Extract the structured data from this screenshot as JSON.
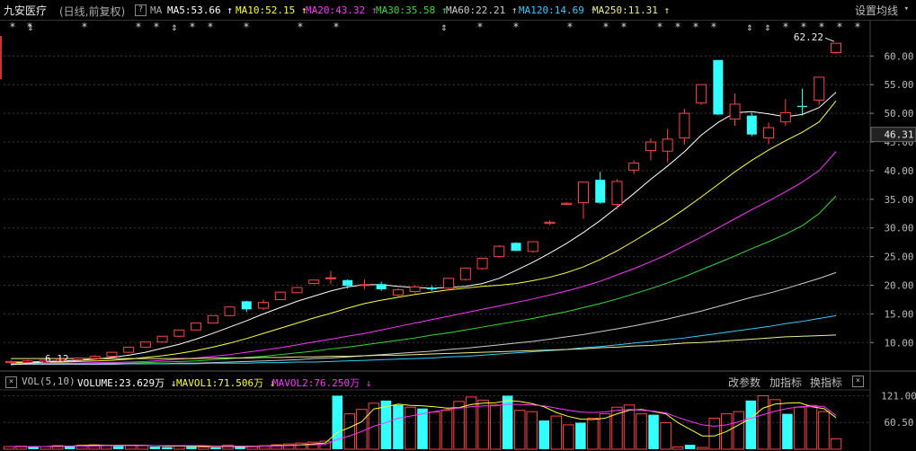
{
  "header": {
    "title": "九安医疗",
    "subtitle": "(日线,前复权)",
    "help_glyph": "?",
    "ma_label": "MA",
    "ma_items": [
      {
        "label": "MA5:53.66",
        "arrow": "↑",
        "color": "#ffffff"
      },
      {
        "label": "MA10:52.15",
        "arrow": "↑",
        "color": "#ffff33"
      },
      {
        "label": "MA20:43.32",
        "arrow": "↑",
        "color": "#ff33ff"
      },
      {
        "label": "MA30:35.58",
        "arrow": "↑",
        "color": "#33dd33"
      },
      {
        "label": "MA60:22.21",
        "arrow": "↑",
        "color": "#cccccc"
      },
      {
        "label": "MA120:14.69",
        "arrow": "↑",
        "color": "#33ccff"
      },
      {
        "label": "MA250:11.31",
        "arrow": "↑",
        "color": "#eeee88"
      }
    ],
    "settings_label": "设置均线",
    "settings_caret": "▾"
  },
  "volume_header": {
    "close_glyph": "×",
    "label": "VOL(5,10)",
    "items": [
      {
        "label": "VOLUME:23.629万",
        "arrow": "↓",
        "color": "#ffffff"
      },
      {
        "label": "MAVOL1:71.506万",
        "arrow": "↓",
        "color": "#ffff33"
      },
      {
        "label": "MAVOL2:76.250万",
        "arrow": "↓",
        "color": "#ff33ff"
      }
    ],
    "buttons": [
      "改参数",
      "加指标",
      "换指标"
    ],
    "panel_close": "×"
  },
  "chart_data": {
    "type": "candlestick",
    "price_axis": {
      "ticks": [
        10,
        15,
        20,
        25,
        30,
        35,
        40,
        45,
        50,
        55,
        60
      ],
      "labels": [
        "10.00",
        "15.00",
        "20.00",
        "25.00",
        "30.00",
        "35.00",
        "40.00",
        "45.00",
        "50.00",
        "55.00",
        "60.00"
      ],
      "ylim": [
        5.5,
        63.5
      ]
    },
    "current_price_label": "46.31",
    "current_price": 46.31,
    "high_label": "62.22",
    "high_value": 62.22,
    "low_label": "6.12",
    "low_value": 6.12,
    "event_markers": [
      "*",
      "*",
      "*",
      "*",
      "*",
      "*",
      "*",
      "*",
      "*",
      "*",
      "*",
      "*",
      "*",
      "*",
      "*",
      "*",
      "*",
      "*",
      "*",
      "*",
      "*",
      "*",
      "*",
      "*",
      "*",
      "*",
      "*",
      "*",
      "*"
    ],
    "candles": [
      {
        "o": 6.5,
        "c": 6.7,
        "h": 6.9,
        "l": 6.3
      },
      {
        "o": 6.5,
        "c": 6.8,
        "h": 7.0,
        "l": 6.4
      },
      {
        "o": 6.6,
        "c": 6.9,
        "h": 7.0,
        "l": 6.5
      },
      {
        "o": 6.8,
        "c": 7.1,
        "h": 7.2,
        "l": 6.7
      },
      {
        "o": 7.0,
        "c": 7.3,
        "h": 7.4,
        "l": 6.9
      },
      {
        "o": 7.2,
        "c": 7.6,
        "h": 7.8,
        "l": 7.1
      },
      {
        "o": 7.6,
        "c": 8.3,
        "h": 8.4,
        "l": 7.5
      },
      {
        "o": 8.3,
        "c": 9.2,
        "h": 9.2,
        "l": 8.2
      },
      {
        "o": 9.2,
        "c": 10.1,
        "h": 10.1,
        "l": 9.1
      },
      {
        "o": 10.1,
        "c": 11.1,
        "h": 11.1,
        "l": 10.0
      },
      {
        "o": 11.1,
        "c": 12.2,
        "h": 12.2,
        "l": 11.0
      },
      {
        "o": 12.2,
        "c": 13.4,
        "h": 13.4,
        "l": 12.1
      },
      {
        "o": 13.4,
        "c": 14.7,
        "h": 14.7,
        "l": 13.3
      },
      {
        "o": 14.7,
        "c": 16.2,
        "h": 16.2,
        "l": 14.6
      },
      {
        "o": 17.2,
        "c": 15.8,
        "h": 17.3,
        "l": 15.3
      },
      {
        "o": 16.0,
        "c": 17.0,
        "h": 17.5,
        "l": 15.7
      },
      {
        "o": 17.5,
        "c": 18.8,
        "h": 18.9,
        "l": 17.4
      },
      {
        "o": 18.7,
        "c": 19.6,
        "h": 19.7,
        "l": 18.6
      },
      {
        "o": 20.3,
        "c": 20.9,
        "h": 21.0,
        "l": 20.2
      },
      {
        "o": 21.3,
        "c": 21.3,
        "h": 22.5,
        "l": 20.2
      },
      {
        "o": 20.9,
        "c": 19.9,
        "h": 21.0,
        "l": 19.4
      },
      {
        "o": 20.0,
        "c": 20.1,
        "h": 21.0,
        "l": 19.3
      },
      {
        "o": 20.2,
        "c": 19.3,
        "h": 20.6,
        "l": 19.0
      },
      {
        "o": 18.3,
        "c": 19.2,
        "h": 19.5,
        "l": 18.0
      },
      {
        "o": 18.9,
        "c": 19.7,
        "h": 20.0,
        "l": 18.6
      },
      {
        "o": 19.6,
        "c": 19.3,
        "h": 19.9,
        "l": 19.0
      },
      {
        "o": 19.5,
        "c": 21.2,
        "h": 21.3,
        "l": 19.1
      },
      {
        "o": 21.0,
        "c": 23.0,
        "h": 23.1,
        "l": 20.8
      },
      {
        "o": 22.9,
        "c": 24.7,
        "h": 24.8,
        "l": 22.7
      },
      {
        "o": 25.0,
        "c": 26.8,
        "h": 27.0,
        "l": 24.8
      },
      {
        "o": 27.4,
        "c": 26.0,
        "h": 27.5,
        "l": 26.0
      },
      {
        "o": 25.9,
        "c": 27.6,
        "h": 27.7,
        "l": 25.7
      },
      {
        "o": 30.8,
        "c": 31.0,
        "h": 31.3,
        "l": 30.5
      },
      {
        "o": 34.1,
        "c": 34.3,
        "h": 34.5,
        "l": 34.0
      },
      {
        "o": 34.4,
        "c": 38.0,
        "h": 38.0,
        "l": 31.6
      },
      {
        "o": 38.4,
        "c": 34.4,
        "h": 39.8,
        "l": 34.2
      },
      {
        "o": 34.1,
        "c": 38.1,
        "h": 38.5,
        "l": 33.2
      },
      {
        "o": 40.1,
        "c": 41.3,
        "h": 41.8,
        "l": 39.4
      },
      {
        "o": 43.5,
        "c": 45.0,
        "h": 45.6,
        "l": 41.8
      },
      {
        "o": 43.4,
        "c": 45.5,
        "h": 47.3,
        "l": 41.5
      },
      {
        "o": 45.7,
        "c": 50.0,
        "h": 50.8,
        "l": 44.5
      },
      {
        "o": 51.8,
        "c": 55.0,
        "h": 55.0,
        "l": 51.5
      },
      {
        "o": 59.3,
        "c": 49.8,
        "h": 59.3,
        "l": 49.7
      },
      {
        "o": 49.0,
        "c": 51.6,
        "h": 53.5,
        "l": 47.8
      },
      {
        "o": 49.6,
        "c": 46.3,
        "h": 50.1,
        "l": 46.0
      },
      {
        "o": 45.7,
        "c": 47.5,
        "h": 48.4,
        "l": 44.6
      },
      {
        "o": 48.5,
        "c": 50.1,
        "h": 52.5,
        "l": 47.8
      },
      {
        "o": 51.3,
        "c": 51.1,
        "h": 54.3,
        "l": 49.6
      },
      {
        "o": 52.3,
        "c": 56.3,
        "h": 56.3,
        "l": 51.5
      },
      {
        "o": 60.6,
        "c": 62.22,
        "h": 62.22,
        "l": 60.4
      }
    ],
    "moving_averages": [
      {
        "name": "MA5",
        "color": "#ffffff",
        "values": [
          6.6,
          6.6,
          6.7,
          6.8,
          6.9,
          7.1,
          7.4,
          7.8,
          8.3,
          9.0,
          9.7,
          10.6,
          11.6,
          12.7,
          13.8,
          15.0,
          16.1,
          17.2,
          18.1,
          19.0,
          19.7,
          20.1,
          20.1,
          19.8,
          19.6,
          19.5,
          19.6,
          19.8,
          20.3,
          21.2,
          22.6,
          24.0,
          25.6,
          27.3,
          29.2,
          31.3,
          33.6,
          36.0,
          38.5,
          40.8,
          43.3,
          46.2,
          48.4,
          50.1,
          50.3,
          49.9,
          49.4,
          49.8,
          51.0,
          53.66
        ]
      },
      {
        "name": "MA10",
        "color": "#ffff33",
        "values": [
          6.5,
          6.5,
          6.6,
          6.6,
          6.7,
          6.8,
          6.9,
          7.1,
          7.4,
          7.7,
          8.1,
          8.6,
          9.2,
          9.9,
          10.7,
          11.6,
          12.5,
          13.4,
          14.3,
          15.1,
          16.0,
          16.8,
          17.4,
          17.9,
          18.4,
          18.8,
          19.2,
          19.5,
          19.8,
          20.0,
          20.3,
          20.8,
          21.4,
          22.2,
          23.2,
          24.5,
          26.0,
          27.7,
          29.5,
          31.3,
          33.3,
          35.4,
          37.6,
          39.8,
          41.8,
          43.6,
          45.2,
          46.7,
          48.5,
          52.15
        ]
      },
      {
        "name": "MA20",
        "color": "#ff33ff",
        "values": [
          6.3,
          6.3,
          6.4,
          6.4,
          6.4,
          6.5,
          6.5,
          6.6,
          6.7,
          6.9,
          7.1,
          7.3,
          7.6,
          7.9,
          8.3,
          8.7,
          9.1,
          9.6,
          10.1,
          10.6,
          11.1,
          11.6,
          12.2,
          12.8,
          13.4,
          14.0,
          14.6,
          15.2,
          15.8,
          16.4,
          17.0,
          17.6,
          18.3,
          19.0,
          19.8,
          20.7,
          21.8,
          22.9,
          24.1,
          25.4,
          26.9,
          28.4,
          30.0,
          31.6,
          33.2,
          34.7,
          36.3,
          38.0,
          40.0,
          43.32
        ]
      },
      {
        "name": "MA30",
        "color": "#33dd33",
        "values": [
          6.2,
          6.2,
          6.2,
          6.3,
          6.3,
          6.3,
          6.4,
          6.4,
          6.5,
          6.6,
          6.7,
          6.8,
          7.0,
          7.2,
          7.4,
          7.6,
          7.9,
          8.2,
          8.5,
          8.9,
          9.2,
          9.6,
          10.0,
          10.4,
          10.8,
          11.3,
          11.7,
          12.2,
          12.7,
          13.2,
          13.7,
          14.2,
          14.8,
          15.4,
          16.1,
          16.8,
          17.6,
          18.5,
          19.4,
          20.4,
          21.5,
          22.7,
          23.9,
          25.1,
          26.4,
          27.6,
          28.9,
          30.4,
          32.5,
          35.58
        ]
      },
      {
        "name": "MA60",
        "color": "#cccccc",
        "values": [
          6.2,
          6.2,
          6.2,
          6.2,
          6.2,
          6.2,
          6.2,
          6.3,
          6.3,
          6.3,
          6.4,
          6.4,
          6.5,
          6.6,
          6.7,
          6.8,
          6.9,
          7.0,
          7.2,
          7.3,
          7.5,
          7.7,
          7.9,
          8.1,
          8.3,
          8.5,
          8.8,
          9.0,
          9.3,
          9.6,
          9.9,
          10.2,
          10.6,
          11.0,
          11.4,
          11.9,
          12.4,
          12.9,
          13.5,
          14.1,
          14.8,
          15.5,
          16.3,
          17.1,
          17.9,
          18.6,
          19.4,
          20.3,
          21.2,
          22.21
        ]
      },
      {
        "name": "MA120",
        "color": "#33ccff",
        "values": [
          6.3,
          6.3,
          6.3,
          6.3,
          6.3,
          6.3,
          6.3,
          6.3,
          6.3,
          6.3,
          6.3,
          6.3,
          6.4,
          6.4,
          6.4,
          6.5,
          6.5,
          6.6,
          6.6,
          6.7,
          6.8,
          6.9,
          7.0,
          7.1,
          7.2,
          7.3,
          7.5,
          7.6,
          7.8,
          8.0,
          8.2,
          8.4,
          8.6,
          8.8,
          9.1,
          9.3,
          9.6,
          9.9,
          10.2,
          10.5,
          10.8,
          11.2,
          11.6,
          12.0,
          12.4,
          12.8,
          13.3,
          13.7,
          14.2,
          14.69
        ]
      },
      {
        "name": "MA250",
        "color": "#eeee88",
        "values": [
          7.2,
          7.2,
          7.2,
          7.2,
          7.2,
          7.2,
          7.2,
          7.2,
          7.2,
          7.2,
          7.2,
          7.2,
          7.3,
          7.3,
          7.3,
          7.4,
          7.4,
          7.5,
          7.5,
          7.6,
          7.6,
          7.7,
          7.8,
          7.8,
          7.9,
          8.0,
          8.1,
          8.2,
          8.3,
          8.4,
          8.5,
          8.6,
          8.7,
          8.8,
          8.9,
          9.1,
          9.2,
          9.4,
          9.5,
          9.7,
          9.9,
          10.0,
          10.2,
          10.4,
          10.6,
          10.8,
          11.0,
          11.1,
          11.2,
          11.31
        ]
      }
    ],
    "volume_axis": {
      "labels": [
        "121.00",
        "60.50"
      ],
      "values": [
        121,
        60.5
      ],
      "ylim": [
        0,
        130
      ]
    },
    "volume": [
      6,
      7,
      5,
      6,
      8,
      7,
      9,
      10,
      8,
      7,
      9,
      8,
      6,
      5,
      8,
      6,
      5,
      4,
      9,
      5,
      7,
      8,
      10,
      12,
      14,
      16,
      18,
      121,
      80,
      90,
      104,
      110,
      100,
      95,
      92,
      84,
      88,
      108,
      118,
      111,
      100,
      121,
      88,
      85,
      65,
      75,
      55,
      60,
      70,
      80,
      95,
      100,
      80,
      78,
      60,
      5,
      10,
      4,
      70,
      80,
      85,
      110,
      121,
      112,
      80,
      95,
      99,
      85,
      23.629
    ],
    "volume_up": [
      true,
      true,
      false,
      true,
      true,
      false,
      true,
      true,
      true,
      false,
      true,
      true,
      false,
      false,
      true,
      false,
      true,
      false,
      true,
      false,
      true,
      true,
      true,
      true,
      true,
      true,
      true,
      false,
      true,
      true,
      true,
      false,
      false,
      true,
      false,
      true,
      true,
      true,
      true,
      true,
      true,
      false,
      true,
      true,
      false,
      true,
      true,
      false,
      true,
      true,
      true,
      true,
      true,
      false,
      true,
      true,
      false,
      true,
      true,
      true,
      true,
      false,
      true,
      true,
      false,
      true,
      true,
      true,
      true
    ],
    "mavol1": [
      6,
      6,
      6,
      6,
      7,
      7,
      8,
      9,
      9,
      9,
      9,
      9,
      8,
      7,
      7,
      7,
      6,
      6,
      6,
      6,
      6,
      7,
      8,
      9,
      10,
      12,
      14,
      38,
      49,
      62,
      91,
      96,
      102,
      99,
      98,
      96,
      93,
      94,
      101,
      104,
      105,
      110,
      108,
      103,
      96,
      83,
      74,
      68,
      67,
      70,
      80,
      88,
      90,
      85,
      80,
      60,
      45,
      30,
      30,
      40,
      55,
      70,
      93,
      102,
      104,
      105,
      96,
      92,
      71.506
    ],
    "mavol2": [
      6,
      6,
      6,
      6,
      6,
      7,
      7,
      7,
      8,
      8,
      8,
      8,
      8,
      8,
      8,
      8,
      8,
      7,
      7,
      7,
      7,
      7,
      7,
      8,
      9,
      10,
      11,
      22,
      30,
      40,
      52,
      60,
      70,
      75,
      80,
      85,
      90,
      93,
      96,
      98,
      98,
      102,
      101,
      100,
      98,
      93,
      88,
      84,
      83,
      84,
      88,
      90,
      88,
      86,
      82,
      72,
      63,
      55,
      52,
      55,
      62,
      70,
      78,
      86,
      92,
      96,
      97,
      97,
      76.25
    ]
  }
}
